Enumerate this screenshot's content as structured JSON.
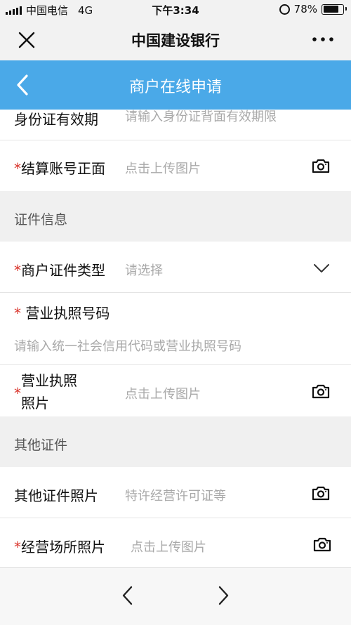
{
  "status": {
    "carrier": "中国电信",
    "network": "4G",
    "time": "下午3:34",
    "battery": "78%",
    "battery_level": 0.78
  },
  "wechat_bar": {
    "title": "中国建设银行",
    "close_icon": "close-icon",
    "more_icon": "more-icon"
  },
  "page_header": {
    "title": "商户在线申请",
    "back_icon": "back-icon",
    "color": "#4aa9e8"
  },
  "rows": {
    "id_validity": {
      "label": "身份证有效期",
      "placeholder": "请输入身份证背面有效期限"
    },
    "settlement_front": {
      "required": "*",
      "label": "结算账号正面",
      "placeholder": "点击上传图片"
    },
    "cert_type": {
      "required": "*",
      "label": "商户证件类型",
      "placeholder": "请选择"
    },
    "license_number": {
      "required": "*",
      "label": "营业执照号码",
      "placeholder": "请输入统一社会信用代码或营业执照号码"
    },
    "license_photo": {
      "required": "*",
      "label_line1": "营业执照",
      "label_line2": "照片",
      "placeholder": "点击上传图片"
    },
    "other_cert_photo": {
      "label": "其他证件照片",
      "placeholder": "特许经营许可证等"
    },
    "premises_photo": {
      "required": "*",
      "label": "经营场所照片",
      "placeholder": "点击上传图片"
    }
  },
  "sections": {
    "cert_info": "证件信息",
    "other_cert": "其他证件"
  },
  "colors": {
    "required": "#d9332a",
    "placeholder": "#a9a9a9"
  }
}
